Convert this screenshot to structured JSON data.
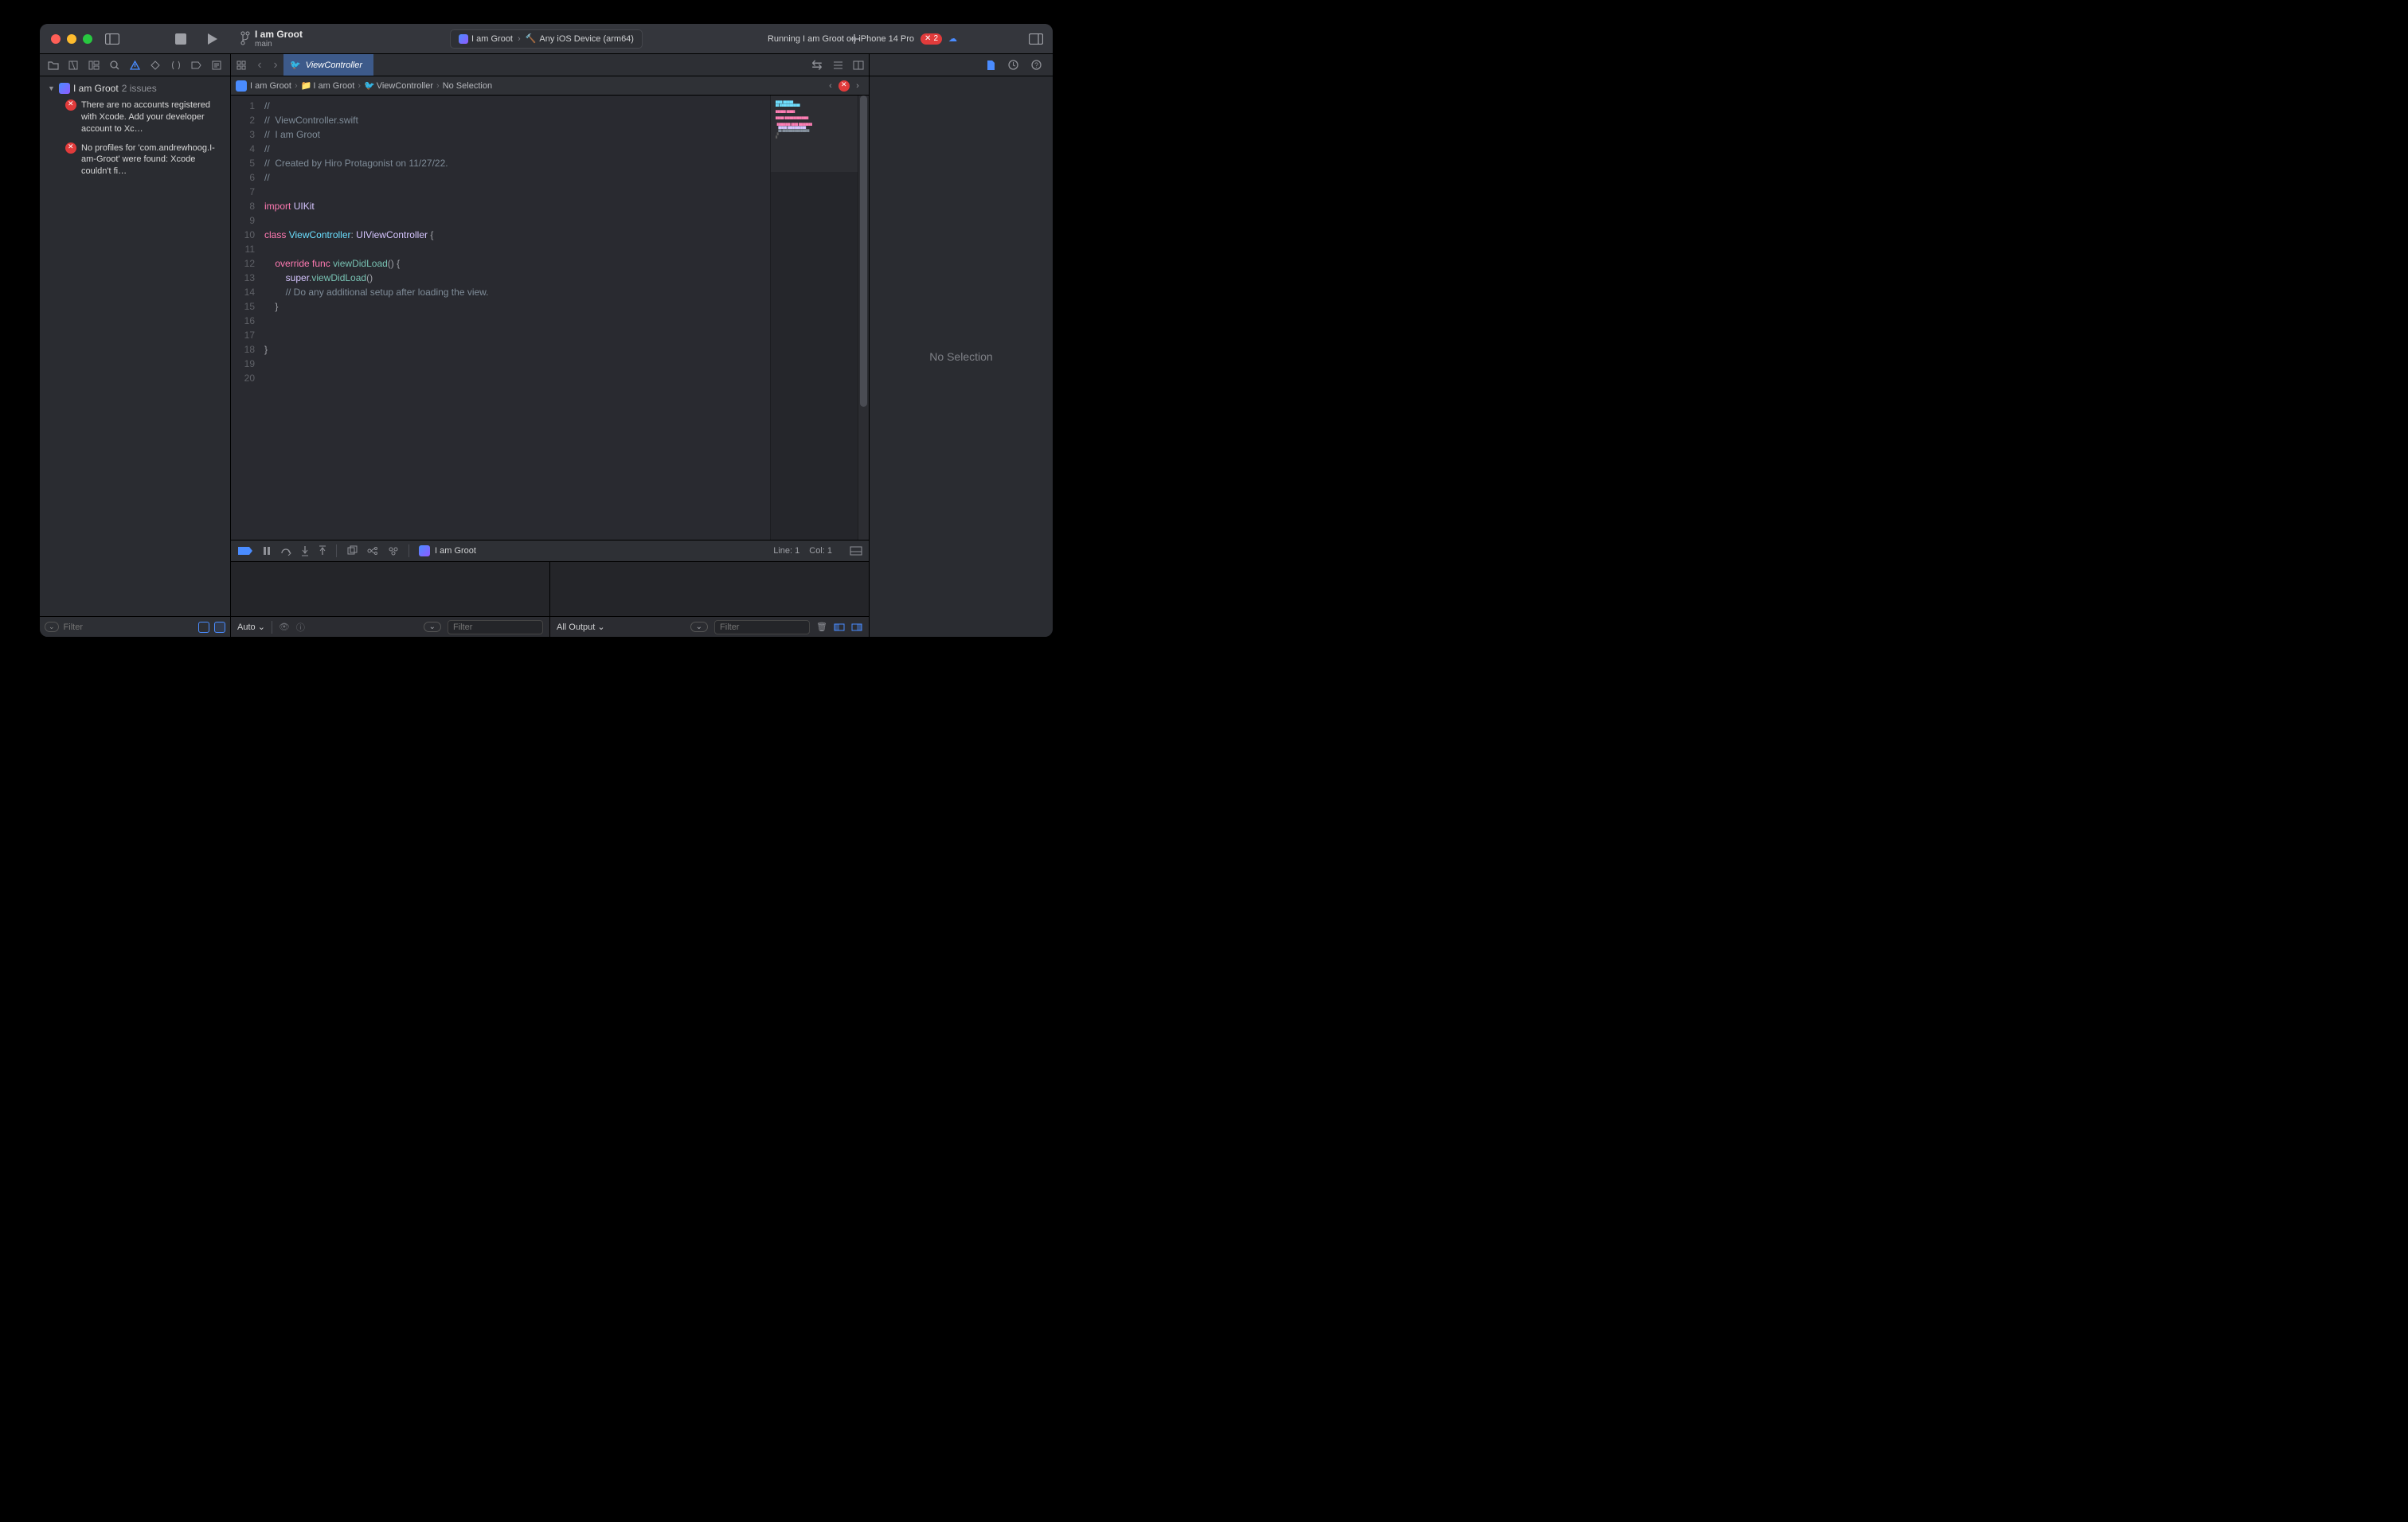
{
  "titlebar": {
    "project_title": "I am Groot",
    "branch": "main",
    "scheme_app": "I am Groot",
    "scheme_device": "Any iOS Device (arm64)",
    "status": "Running I am Groot on iPhone 14 Pro",
    "error_count": "2"
  },
  "navigator": {
    "root": "I am Groot",
    "issue_count": "2 issues",
    "issues": [
      "There are no accounts registered with Xcode. Add your developer account to Xc…",
      "No profiles for 'com.andrewhoog.I-am-Groot' were found: Xcode couldn't fi…"
    ],
    "filter_placeholder": "Filter"
  },
  "tab": {
    "filename": "ViewController"
  },
  "jumpbar": {
    "items": [
      "I am Groot",
      "I am Groot",
      "ViewController",
      "No Selection"
    ]
  },
  "code": {
    "lines": [
      "//",
      "//  ViewController.swift",
      "//  I am Groot",
      "//",
      "//  Created by Hiro Protagonist on 11/27/22.",
      "//",
      "",
      "import UIKit",
      "",
      "class ViewController: UIViewController {",
      "",
      "    override func viewDidLoad() {",
      "        super.viewDidLoad()",
      "        // Do any additional setup after loading the view.",
      "    }",
      "",
      "",
      "}",
      "",
      ""
    ],
    "line_numbers": [
      "1",
      "2",
      "3",
      "4",
      "5",
      "6",
      "7",
      "8",
      "9",
      "10",
      "11",
      "12",
      "13",
      "14",
      "15",
      "16",
      "17",
      "18",
      "19",
      "20"
    ]
  },
  "debug": {
    "target": "I am Groot",
    "status_line": "Line: 1",
    "status_col": "Col: 1",
    "auto_label": "Auto",
    "all_output": "All Output",
    "filter_placeholder": "Filter"
  },
  "inspector": {
    "no_selection": "No Selection"
  }
}
